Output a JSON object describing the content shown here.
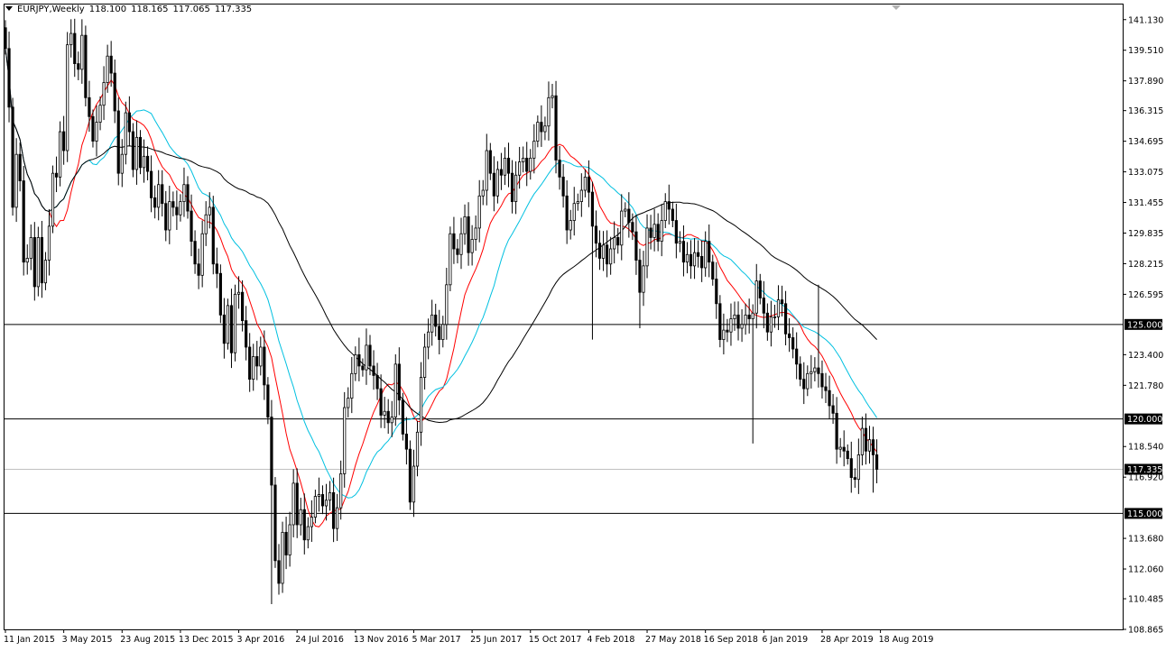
{
  "header": {
    "symbol": "EURJPY,Weekly",
    "open": "118.100",
    "high": "118.165",
    "low": "117.065",
    "close": "117.335"
  },
  "chart_data": {
    "type": "candlestick",
    "symbol": "EURJPY",
    "timeframe": "Weekly",
    "y_ticks": [
      "141.130",
      "139.510",
      "137.890",
      "136.315",
      "134.695",
      "133.075",
      "131.455",
      "129.835",
      "128.215",
      "126.595",
      "123.400",
      "121.780",
      "118.540",
      "116.920",
      "113.680",
      "112.060",
      "110.485",
      "108.865"
    ],
    "ylim": [
      108.865,
      141.93
    ],
    "x_ticks": [
      {
        "label": "11 Jan 2015",
        "i": 0
      },
      {
        "label": "3 May 2015",
        "i": 16
      },
      {
        "label": "23 Aug 2015",
        "i": 32
      },
      {
        "label": "13 Dec 2015",
        "i": 48
      },
      {
        "label": "3 Apr 2016",
        "i": 64
      },
      {
        "label": "24 Jul 2016",
        "i": 80
      },
      {
        "label": "13 Nov 2016",
        "i": 96
      },
      {
        "label": "5 Mar 2017",
        "i": 112
      },
      {
        "label": "25 Jun 2017",
        "i": 128
      },
      {
        "label": "15 Oct 2017",
        "i": 144
      },
      {
        "label": "4 Feb 2018",
        "i": 160
      },
      {
        "label": "27 May 2018",
        "i": 176
      },
      {
        "label": "16 Sep 2018",
        "i": 192
      },
      {
        "label": "6 Jan 2019",
        "i": 208
      },
      {
        "label": "28 Apr 2019",
        "i": 224
      },
      {
        "label": "18 Aug 2019",
        "i": 240
      }
    ],
    "horizontal_lines": [
      {
        "value": 125.0,
        "label": "125.000",
        "color": "#000000"
      },
      {
        "value": 120.0,
        "label": "120.000",
        "color": "#000000"
      },
      {
        "value": 115.0,
        "label": "115.000",
        "color": "#000000"
      },
      {
        "value": 117.335,
        "label": "117.335",
        "color": "#c0c0c0"
      }
    ],
    "close_series": [
      139.6,
      136.5,
      131.2,
      134.0,
      132.6,
      128.3,
      128.5,
      129.6,
      127.0,
      129.6,
      127.2,
      128.4,
      130.2,
      133.0,
      132.8,
      135.2,
      134.2,
      139.8,
      140.4,
      138.8,
      138.5,
      140.3,
      137.0,
      136.0,
      134.7,
      135.7,
      136.6,
      137.8,
      139.2,
      138.3,
      136.3,
      133.0,
      134.0,
      136.2,
      135.2,
      133.2,
      134.9,
      133.3,
      133.9,
      133.1,
      131.7,
      131.2,
      132.4,
      131.4,
      130.0,
      131.5,
      131.2,
      130.8,
      131.5,
      132.4,
      131.0,
      129.4,
      128.2,
      127.6,
      129.8,
      130.8,
      131.2,
      128.2,
      127.7,
      125.5,
      124.0,
      126.0,
      123.5,
      126.6,
      126.7,
      125.2,
      123.8,
      122.1,
      123.3,
      122.8,
      123.8,
      121.8,
      120.1,
      116.5,
      112.5,
      111.3,
      114.0,
      112.8,
      114.4,
      116.6,
      114.4,
      115.2,
      113.6,
      114.3,
      114.8,
      115.9,
      116.0,
      115.4,
      115.7,
      116.1,
      114.2,
      115.3,
      117.1,
      120.6,
      121.1,
      122.4,
      123.4,
      122.8,
      122.6,
      123.9,
      122.8,
      122.3,
      121.6,
      120.2,
      120.4,
      119.8,
      120.1,
      122.9,
      121.0,
      119.2,
      118.4,
      115.6,
      117.5,
      119.3,
      122.2,
      123.8,
      124.6,
      125.5,
      124.9,
      124.2,
      125.0,
      127.1,
      129.8,
      129.0,
      128.7,
      129.8,
      130.7,
      128.8,
      129.5,
      130.1,
      131.8,
      132.1,
      134.2,
      133.0,
      131.8,
      133.2,
      132.9,
      133.8,
      133.0,
      131.5,
      132.9,
      133.6,
      133.8,
      133.1,
      133.8,
      134.7,
      135.7,
      135.2,
      135.5,
      137.0,
      137.1,
      133.7,
      132.8,
      131.8,
      130.0,
      130.5,
      131.4,
      131.5,
      132.1,
      132.8,
      132.0,
      130.2,
      129.3,
      128.5,
      129.2,
      128.2,
      129.0,
      129.6,
      129.2,
      131.0,
      131.1,
      130.4,
      129.9,
      128.4,
      126.7,
      128.1,
      130.1,
      129.6,
      130.3,
      129.4,
      130.5,
      131.5,
      131.1,
      130.5,
      129.3,
      129.4,
      128.3,
      128.7,
      128.1,
      128.8,
      128.6,
      128.0,
      129.4,
      128.3,
      127.4,
      126.1,
      124.2,
      124.7,
      124.6,
      125.3,
      125.5,
      124.8,
      125.0,
      125.5,
      125.3,
      125.6,
      127.3,
      126.4,
      125.6,
      124.6,
      125.4,
      125.4,
      126.3,
      126.1,
      124.5,
      124.3,
      123.7,
      122.9,
      122.1,
      121.6,
      122.4,
      122.5,
      122.7,
      122.4,
      121.7,
      121.5,
      120.7,
      120.3,
      118.4,
      118.5,
      118.3,
      117.9,
      116.9,
      116.8,
      118.1,
      119.5,
      118.3,
      118.9,
      118.1,
      117.335
    ]
  },
  "colors": {
    "candle_up_body": "#ffffff",
    "candle_down_body": "#000000",
    "candle_wick": "#000000",
    "ma_fast": "#ff0000",
    "ma_mid": "#00c0e0",
    "ma_slow": "#000000",
    "grid_axis": "#000000",
    "price_tag_bg": "#000000"
  }
}
